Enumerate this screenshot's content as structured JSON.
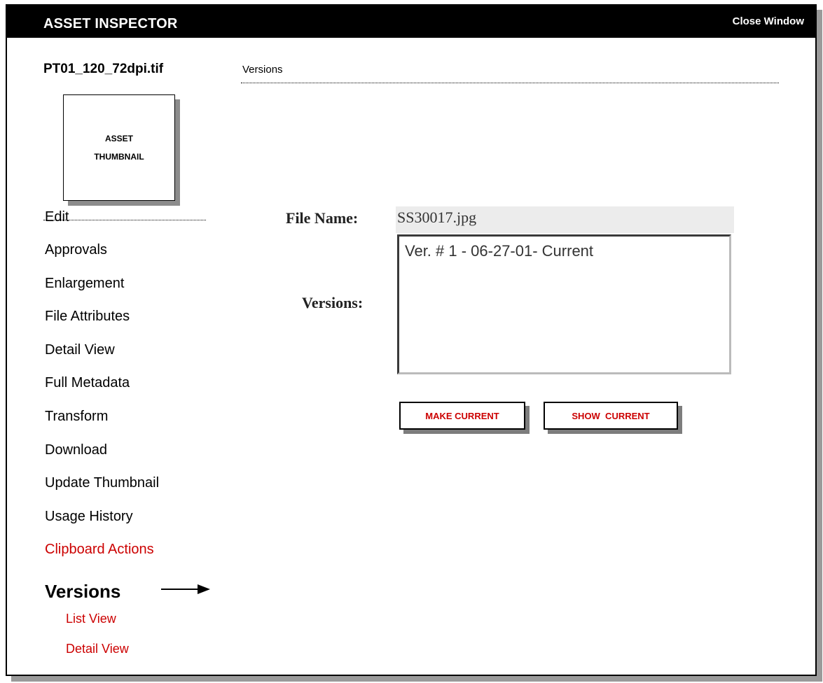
{
  "window": {
    "title": "ASSET INSPECTOR",
    "close_label": "Close Window"
  },
  "asset": {
    "file_name": "PT01_120_72dpi.tif",
    "thumbnail_lines": [
      "ASSET",
      "THUMBNAIL"
    ]
  },
  "section": {
    "label": "Versions"
  },
  "nav": {
    "items": [
      "Edit",
      "Approvals",
      "Enlargement",
      "File Attributes",
      "Detail View",
      "Full Metadata",
      "Transform",
      "Download",
      "Update Thumbnail",
      "Usage History"
    ],
    "clipboard_label": "Clipboard Actions",
    "versions_heading": "Versions",
    "sub_items": [
      "List View",
      "Detail View"
    ]
  },
  "form": {
    "file_name_label": "File Name:",
    "file_name_value": "SS30017.jpg",
    "versions_label": "Versions:",
    "versions_options": [
      "Ver. # 1 - 06-27-01- Current"
    ]
  },
  "buttons": {
    "make_current": "MAKE CURRENT",
    "show_current": "SHOW  CURRENT"
  },
  "colors": {
    "accent_red": "#cc0000",
    "title_bar": "#000000"
  }
}
